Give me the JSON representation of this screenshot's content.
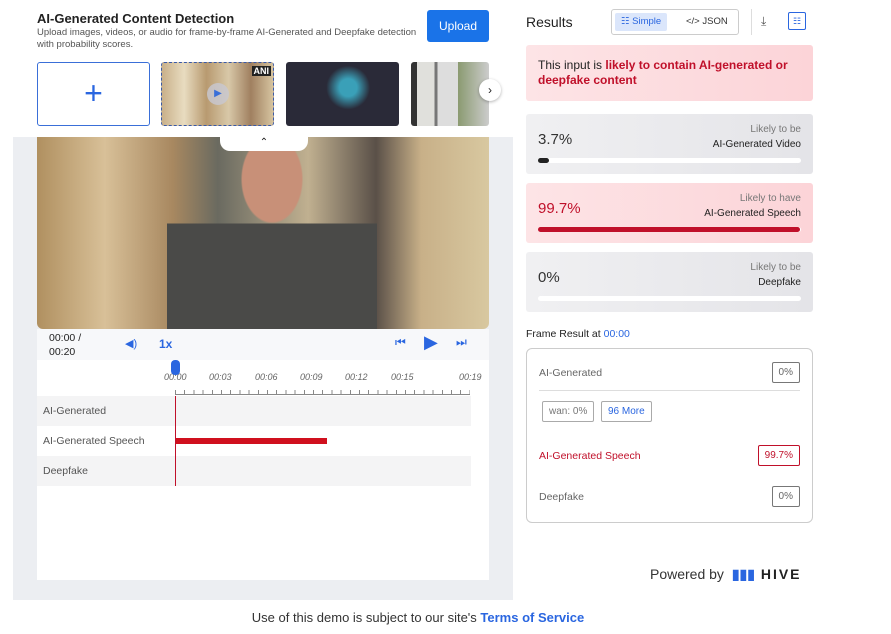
{
  "header": {
    "title": "AI-Generated Content Detection",
    "subtitle": "Upload images, videos, or audio for frame-by-frame AI-Generated and Deepfake detection with probability scores.",
    "upload_label": "Upload"
  },
  "thumbnails": {
    "add": "+",
    "watermark": "ANI",
    "play": "▶",
    "next": "›"
  },
  "player": {
    "time_current": "00:00 /",
    "time_total": "00:20",
    "speed": "1x",
    "collapse": "⌃"
  },
  "timeline": {
    "ticks": [
      "00:00",
      "00:03",
      "00:06",
      "00:09",
      "00:12",
      "00:15",
      "00:19"
    ],
    "rows": [
      "AI-Generated",
      "AI-Generated Speech",
      "Deepfake"
    ],
    "speech_segment_end": "00:10"
  },
  "results": {
    "title": "Results",
    "simple": "Simple",
    "json": "</> JSON",
    "alert_prefix": "This input is ",
    "alert_bold": "likely to contain AI-generated or deepfake content",
    "cards": [
      {
        "pct": "3.7%",
        "l1": "Likely to be",
        "l2": "AI-Generated Video",
        "value": 3.7
      },
      {
        "pct": "99.7%",
        "l1": "Likely to have",
        "l2": "AI-Generated Speech",
        "value": 99.7
      },
      {
        "pct": "0%",
        "l1": "Likely to be",
        "l2": "Deepfake",
        "value": 0
      }
    ],
    "frame_label": "Frame Result at ",
    "frame_time": "00:00",
    "frame": {
      "ai": "AI-Generated",
      "ai_val": "0%",
      "chip1": "wan: 0%",
      "chip2": "96 More",
      "speech": "AI-Generated Speech",
      "speech_val": "99.7%",
      "deepfake": "Deepfake",
      "deepfake_val": "0%"
    }
  },
  "powered": {
    "label": "Powered by",
    "brand": "HIVE"
  },
  "footer": {
    "text": "Use of this demo is subject to our site's ",
    "link": "Terms of Service"
  },
  "colors": {
    "accent": "#2a66e0",
    "danger": "#c0102a"
  }
}
